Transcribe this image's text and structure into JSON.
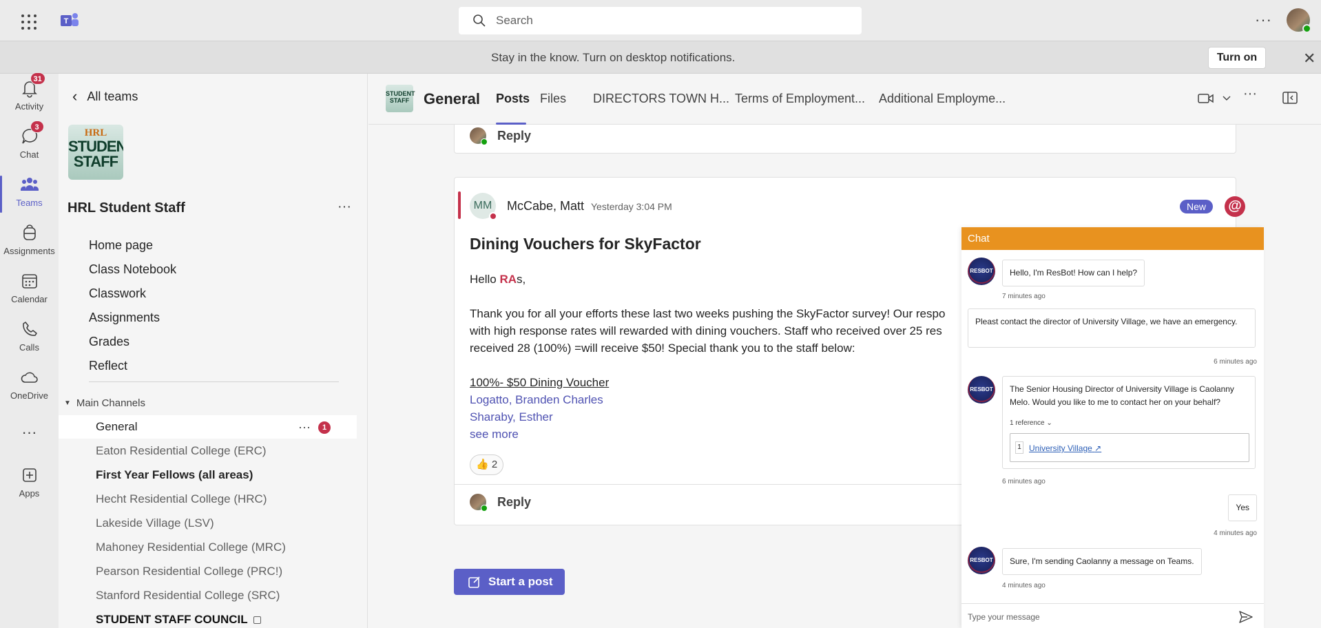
{
  "topbar": {
    "search_placeholder": "Search",
    "more": "···"
  },
  "banner": {
    "text": "Stay in the know. Turn on desktop notifications.",
    "turn_on": "Turn on",
    "close": "✕"
  },
  "rail": {
    "items": [
      {
        "label": "Activity",
        "badge": "31"
      },
      {
        "label": "Chat",
        "badge": "3"
      },
      {
        "label": "Teams"
      },
      {
        "label": "Assignments"
      },
      {
        "label": "Calendar"
      },
      {
        "label": "Calls"
      },
      {
        "label": "OneDrive"
      },
      {
        "label": "Apps"
      }
    ],
    "more": "···"
  },
  "team": {
    "back_label": "All teams",
    "avatar_line1": "HRL",
    "avatar_line2": "STUDENT",
    "avatar_line3": "STAFF",
    "name": "HRL Student Staff",
    "more": "···",
    "nav": [
      "Home page",
      "Class Notebook",
      "Classwork",
      "Assignments",
      "Grades",
      "Reflect"
    ],
    "section_label": "Main Channels",
    "channels": [
      {
        "name": "General",
        "badge": "1"
      },
      {
        "name": "Eaton Residential College (ERC)"
      },
      {
        "name": "First Year Fellows (all areas)"
      },
      {
        "name": "Hecht Residential College (HRC)"
      },
      {
        "name": "Lakeside Village (LSV)"
      },
      {
        "name": "Mahoney Residential College (MRC)"
      },
      {
        "name": "Pearson Residential College (PRC!)"
      },
      {
        "name": "Stanford Residential College (SRC)"
      },
      {
        "name": "STUDENT STAFF COUNCIL"
      }
    ]
  },
  "channel_header": {
    "icon_text": "STUDENT STAFF",
    "title": "General",
    "tabs": [
      "Posts",
      "Files",
      "DIRECTORS TOWN H...",
      "Terms of Employment...",
      "Additional Employme..."
    ]
  },
  "feed": {
    "reply_label": "Reply",
    "post": {
      "initials": "MM",
      "author": "McCabe, Matt",
      "time": "Yesterday 3:04 PM",
      "new_label": "New",
      "mention_icon": "@",
      "title": "Dining Vouchers for SkyFactor",
      "greeting_pre": "Hello ",
      "greeting_ra": "RA",
      "greeting_post": "s,",
      "line1": "Thank you for all your efforts these last two weeks pushing the SkyFactor survey! Our respo",
      "line2": "with high response rates will rewarded with dining vouchers. Staff who received over 25 res",
      "line3": "received 28 (100%) =will receive $50! Special thank you to the staff below:",
      "voucher_heading": "100%- $50 Dining Voucher",
      "staff": [
        "Logatto, Branden Charles",
        "Sharaby, Esther"
      ],
      "see_more": "see more",
      "reaction_emoji": "👍",
      "reaction_count": "2"
    },
    "start_post": "Start a post"
  },
  "resbot": {
    "header": "Chat",
    "bot_label": "RESBOT",
    "messages": [
      {
        "from": "bot",
        "text": "Hello, I'm ResBot! How can I help?",
        "time": "7 minutes ago"
      },
      {
        "from": "user",
        "text": "Pleast contact the director of University Village, we have an emergency.",
        "time": "6 minutes ago"
      },
      {
        "from": "bot",
        "text": "The Senior Housing Director of University Village is Caolanny Melo. Would you like to me to contact her on your behalf?",
        "time": "6 minutes ago",
        "reference_toggle": "1 reference",
        "reference_num": "1",
        "reference_link": "University Village"
      },
      {
        "from": "user",
        "text": "Yes",
        "time": "4 minutes ago"
      },
      {
        "from": "bot",
        "text": "Sure, I'm sending Caolanny a message on Teams.",
        "time": "4 minutes ago"
      }
    ],
    "input_placeholder": "Type your message"
  }
}
